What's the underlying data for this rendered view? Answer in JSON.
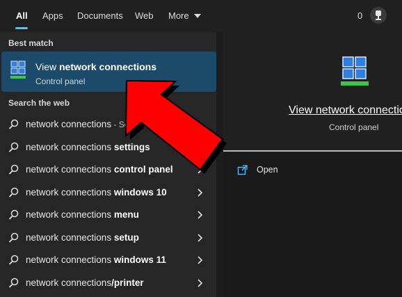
{
  "tabs": [
    {
      "label": "All"
    },
    {
      "label": "Apps"
    },
    {
      "label": "Documents"
    },
    {
      "label": "Web"
    },
    {
      "label": "More"
    }
  ],
  "topbar": {
    "count": "0"
  },
  "left": {
    "best_match_label": "Best match",
    "best_match": {
      "title_prefix": "View ",
      "title_bold": "network connections",
      "subtitle": "Control panel"
    },
    "search_web_label": "Search the web",
    "suggestions": [
      {
        "prefix": "network connections",
        "bold": "",
        "hint": " - See web r"
      },
      {
        "prefix": "network connections ",
        "bold": "settings",
        "hint": ""
      },
      {
        "prefix": "network connections ",
        "bold": "control panel",
        "hint": ""
      },
      {
        "prefix": "network connections ",
        "bold": "windows 10",
        "hint": ""
      },
      {
        "prefix": "network connections ",
        "bold": "menu",
        "hint": ""
      },
      {
        "prefix": "network connections ",
        "bold": "setup",
        "hint": ""
      },
      {
        "prefix": "network connections ",
        "bold": "windows 11",
        "hint": ""
      },
      {
        "prefix": "network connections",
        "bold": "/printer",
        "hint": ""
      }
    ]
  },
  "right": {
    "title": "View network connections",
    "subtitle": "Control panel",
    "open_label": "Open"
  },
  "colors": {
    "accent": "#4cc2ff",
    "selected_bg": "#1b4a6b",
    "arrow_red": "#ff0000"
  }
}
